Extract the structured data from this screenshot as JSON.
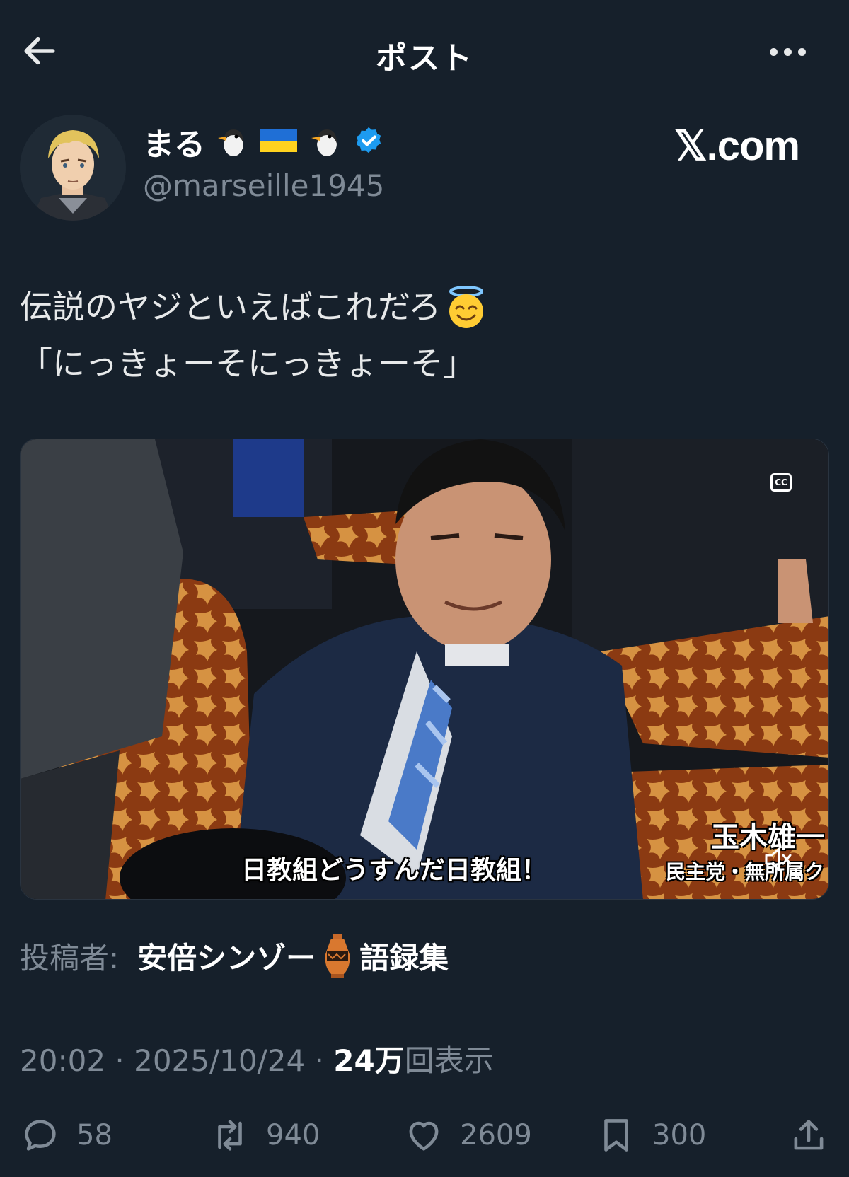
{
  "header": {
    "title": "ポスト"
  },
  "author": {
    "display_name": "まる",
    "name_emojis": [
      "penguin-icon",
      "ukraine-flag-icon",
      "penguin-icon"
    ],
    "handle": "@marseille1945",
    "verified": true
  },
  "watermark": "𝕏.com",
  "tweet": {
    "line1": "伝説のヤジといえばこれだろ",
    "line2": "「にっきょーそにっきょーそ」"
  },
  "media": {
    "subtitle": "日教組どうすんだ日教組！",
    "caption_name": "玉木雄一",
    "caption_party": "民主党・無所属ク",
    "cc_label": "CC"
  },
  "attribution": {
    "label": "投稿者:",
    "source_prefix": "安倍シンゾー",
    "source_suffix": "語録集"
  },
  "meta": {
    "time": "20:02",
    "separator": " · ",
    "date": "2025/10/24",
    "views_count": "24万",
    "views_label": "回表示"
  },
  "actions": {
    "replies": "58",
    "reposts": "940",
    "likes": "2609",
    "bookmarks": "300"
  },
  "colors": {
    "background": "#16202b",
    "text": "#e7e9ea",
    "muted": "#7f8a96",
    "verified": "#1d9bf0"
  }
}
